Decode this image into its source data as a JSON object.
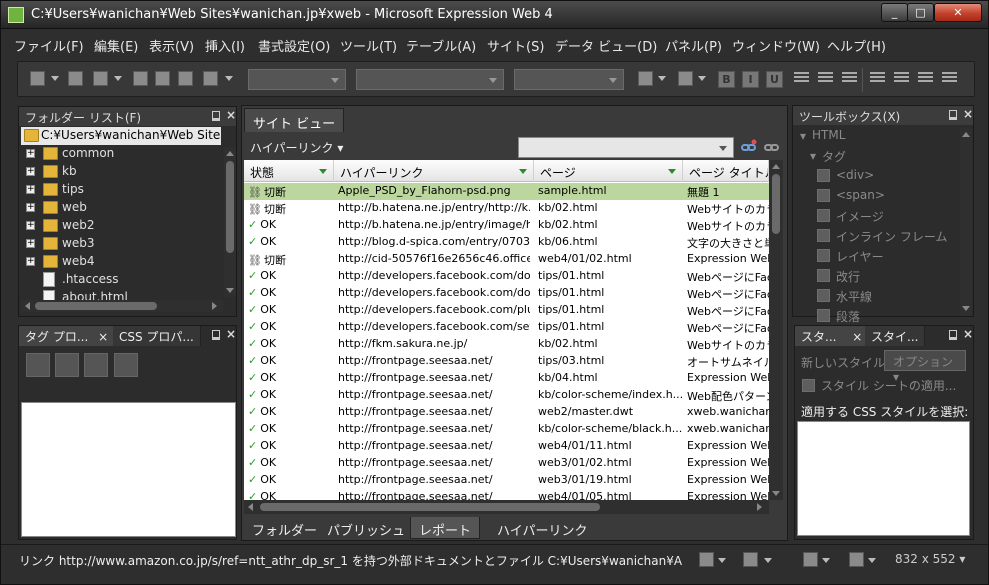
{
  "window": {
    "title": "C:¥Users¥wanichan¥Web Sites¥wanichan.jp¥xweb - Microsoft Expression Web 4"
  },
  "menu": [
    "ファイル(F)",
    "編集(E)",
    "表示(V)",
    "挿入(I)",
    "書式設定(O)",
    "ツール(T)",
    "テーブル(A)",
    "サイト(S)",
    "データ ビュー(D)",
    "パネル(P)",
    "ウィンドウ(W)",
    "ヘルプ(H)"
  ],
  "toolbar": {
    "format_buttons": [
      "B",
      "I",
      "U"
    ]
  },
  "folder_panel": {
    "title": "フォルダー リスト(F)",
    "root_path": "C:¥Users¥wanichan¥Web Sites¥wan",
    "items": [
      {
        "label": "common",
        "type": "folder"
      },
      {
        "label": "kb",
        "type": "folder"
      },
      {
        "label": "tips",
        "type": "folder"
      },
      {
        "label": "web",
        "type": "folder"
      },
      {
        "label": "web2",
        "type": "folder"
      },
      {
        "label": "web3",
        "type": "folder"
      },
      {
        "label": "web4",
        "type": "folder"
      },
      {
        "label": ".htaccess",
        "type": "file"
      },
      {
        "label": "about.html",
        "type": "file"
      }
    ]
  },
  "tag_panel": {
    "tab1": "タグ プロ...",
    "tab2": "CSS プロパ..."
  },
  "site_view": {
    "tab": "サイト ビュー",
    "hyperlink_menu": "ハイパーリンク ▾",
    "columns": [
      "状態",
      "ハイパーリンク",
      "ページ",
      "ページ タイトル"
    ],
    "rows": [
      {
        "status": "切断",
        "broken": true,
        "link": "Apple_PSD_by_Flahorn-psd.png",
        "page": "sample.html",
        "title": "無題 1",
        "selected": true
      },
      {
        "status": "切断",
        "broken": true,
        "link": "http://b.hatena.ne.jp/entry/http://k...",
        "page": "kb/02.html",
        "title": "Webサイトのカラー"
      },
      {
        "status": "OK",
        "broken": false,
        "link": "http://b.hatena.ne.jp/entry/image/h...",
        "page": "kb/02.html",
        "title": "Webサイトのカラー"
      },
      {
        "status": "OK",
        "broken": false,
        "link": "http://blog.d-spica.com/entry/0703...",
        "page": "kb/06.html",
        "title": "文字の大きさと単"
      },
      {
        "status": "切断",
        "broken": true,
        "link": "http://cid-50576f16e2656c46.office....",
        "page": "web4/01/02.html",
        "title": "Expression Web"
      },
      {
        "status": "OK",
        "broken": false,
        "link": "http://developers.facebook.com/do...",
        "page": "tips/01.html",
        "title": "WebページにFac"
      },
      {
        "status": "OK",
        "broken": false,
        "link": "http://developers.facebook.com/do...",
        "page": "tips/01.html",
        "title": "WebページにFac"
      },
      {
        "status": "OK",
        "broken": false,
        "link": "http://developers.facebook.com/plu...",
        "page": "tips/01.html",
        "title": "WebページにFac"
      },
      {
        "status": "OK",
        "broken": false,
        "link": "http://developers.facebook.com/set...",
        "page": "tips/01.html",
        "title": "WebページにFac"
      },
      {
        "status": "OK",
        "broken": false,
        "link": "http://fkm.sakura.ne.jp/",
        "page": "kb/02.html",
        "title": "Webサイトのカラー"
      },
      {
        "status": "OK",
        "broken": false,
        "link": "http://frontpage.seesaa.net/",
        "page": "tips/03.html",
        "title": "オートサムネイル画"
      },
      {
        "status": "OK",
        "broken": false,
        "link": "http://frontpage.seesaa.net/",
        "page": "kb/04.html",
        "title": "Expression Web"
      },
      {
        "status": "OK",
        "broken": false,
        "link": "http://frontpage.seesaa.net/",
        "page": "kb/color-scheme/index.h...",
        "title": "Web配色パターン"
      },
      {
        "status": "OK",
        "broken": false,
        "link": "http://frontpage.seesaa.net/",
        "page": "web2/master.dwt",
        "title": "xweb.wanichan.jp"
      },
      {
        "status": "OK",
        "broken": false,
        "link": "http://frontpage.seesaa.net/",
        "page": "kb/color-scheme/black.h...",
        "title": "xweb.wanichan.jp"
      },
      {
        "status": "OK",
        "broken": false,
        "link": "http://frontpage.seesaa.net/",
        "page": "web4/01/11.html",
        "title": "Expression Web"
      },
      {
        "status": "OK",
        "broken": false,
        "link": "http://frontpage.seesaa.net/",
        "page": "web3/01/02.html",
        "title": "Expression Web"
      },
      {
        "status": "OK",
        "broken": false,
        "link": "http://frontpage.seesaa.net/",
        "page": "web3/01/19.html",
        "title": "Expression Web"
      },
      {
        "status": "OK",
        "broken": false,
        "link": "http://frontpage.seesaa.net/",
        "page": "web4/01/05.html",
        "title": "Expression Web"
      }
    ],
    "bottom_tabs": [
      "フォルダー",
      "パブリッシュ",
      "レポート",
      "ハイパーリンク"
    ],
    "active_bottom_tab": 2
  },
  "toolbox": {
    "title": "ツールボックス(X)",
    "items": [
      {
        "label": "HTML",
        "level": 0,
        "icon": false
      },
      {
        "label": "タグ",
        "level": 1,
        "icon": false
      },
      {
        "label": "<div>",
        "level": 2,
        "icon": true
      },
      {
        "label": "<span>",
        "level": 2,
        "icon": true
      },
      {
        "label": "イメージ",
        "level": 2,
        "icon": true
      },
      {
        "label": "インライン フレーム",
        "level": 2,
        "icon": true
      },
      {
        "label": "レイヤー",
        "level": 2,
        "icon": true
      },
      {
        "label": "改行",
        "level": 2,
        "icon": true
      },
      {
        "label": "水平線",
        "level": 2,
        "icon": true
      },
      {
        "label": "段落",
        "level": 2,
        "icon": true
      }
    ]
  },
  "style_panel": {
    "tab1": "スタ...",
    "tab2": "スタイ...",
    "new_style": "新しいスタイル...",
    "options": "オプション ▾",
    "attach": "スタイル シートの適用...",
    "apply_label": "適用する CSS スタイルを選択:"
  },
  "status": {
    "text": "リンク http://www.amazon.co.jp/s/ref=ntt_athr_dp_sr_1 を持つ外部ドキュメントとファイル C:¥Users¥wanichan¥A",
    "size": "832 x 552 ▾"
  },
  "colors": {
    "selected_row": "#bcd79e",
    "ok_check": "#2a9b2a",
    "chrome": "#2e2e2e"
  }
}
